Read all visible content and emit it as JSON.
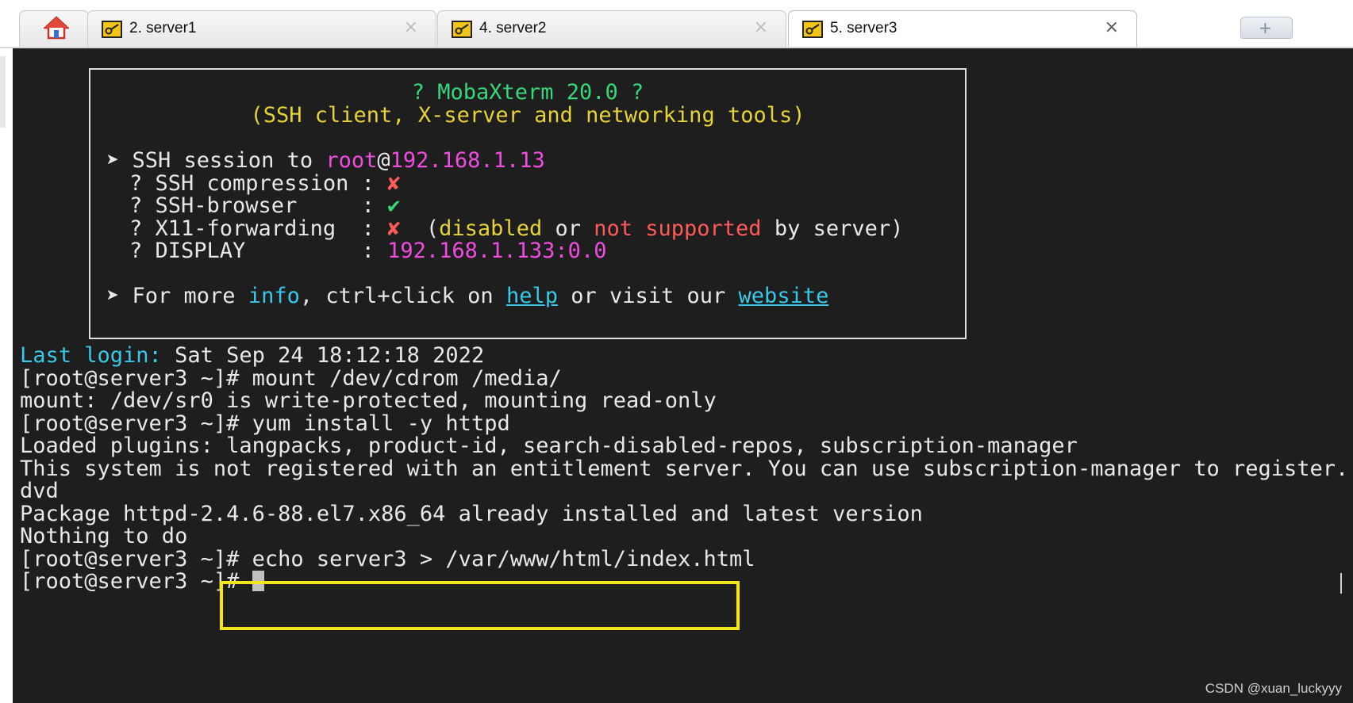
{
  "tabs": [
    {
      "label": "2. server1",
      "close": "×"
    },
    {
      "label": "4. server2",
      "close": "×"
    },
    {
      "label": "5. server3",
      "close": "×"
    }
  ],
  "new_tab": "+",
  "banner": {
    "title": "? MobaXterm 20.0 ?",
    "subtitle": "(SSH client, X-server and networking tools)",
    "ssh_prefix": "➤ SSH session to ",
    "ssh_user": "root",
    "ssh_at": "@",
    "ssh_host": "192.168.1.13",
    "compression_label": "? SSH compression : ",
    "compression_mark": "✘",
    "browser_label": "? SSH-browser     : ",
    "browser_mark": "✔",
    "x11_label": "? X11-forwarding  : ",
    "x11_mark": "✘",
    "x11_open": "  (",
    "x11_disabled": "disabled",
    "x11_or": " or ",
    "x11_not_supported": "not supported",
    "x11_by": " by server)",
    "display_label": "? DISPLAY         : ",
    "display_value": "192.168.1.133:0.0",
    "more_prefix": "➤ For more ",
    "more_info": "info",
    "more_mid": ", ctrl+click on ",
    "more_help": "help",
    "more_visit": " or visit our ",
    "more_website": "website"
  },
  "terminal": {
    "last_login_label": "Last login:",
    "last_login_value": " Sat Sep 24 18:12:18 2022",
    "lines": [
      "[root@server3 ~]# mount /dev/cdrom /media/",
      "mount: /dev/sr0 is write-protected, mounting read-only",
      "[root@server3 ~]# yum install -y httpd",
      "Loaded plugins: langpacks, product-id, search-disabled-repos, subscription-manager",
      "This system is not registered with an entitlement server. You can use subscription-manager to register.",
      "dvd",
      "Package httpd-2.4.6-88.el7.x86_64 already installed and latest version",
      "Nothing to do",
      "[root@server3 ~]# echo server3 > /var/www/html/index.html"
    ],
    "prompt": "[root@server3 ~]# "
  },
  "watermark": "CSDN @xuan_luckyyy",
  "colors": {
    "terminal_bg": "#1e1e1e",
    "highlight_border": "#f5e61a",
    "cyan": "#38c8e8",
    "yellow": "#e6d23a",
    "magenta": "#f04ce0",
    "red": "#ff5a5a",
    "green": "#3ad67a"
  }
}
